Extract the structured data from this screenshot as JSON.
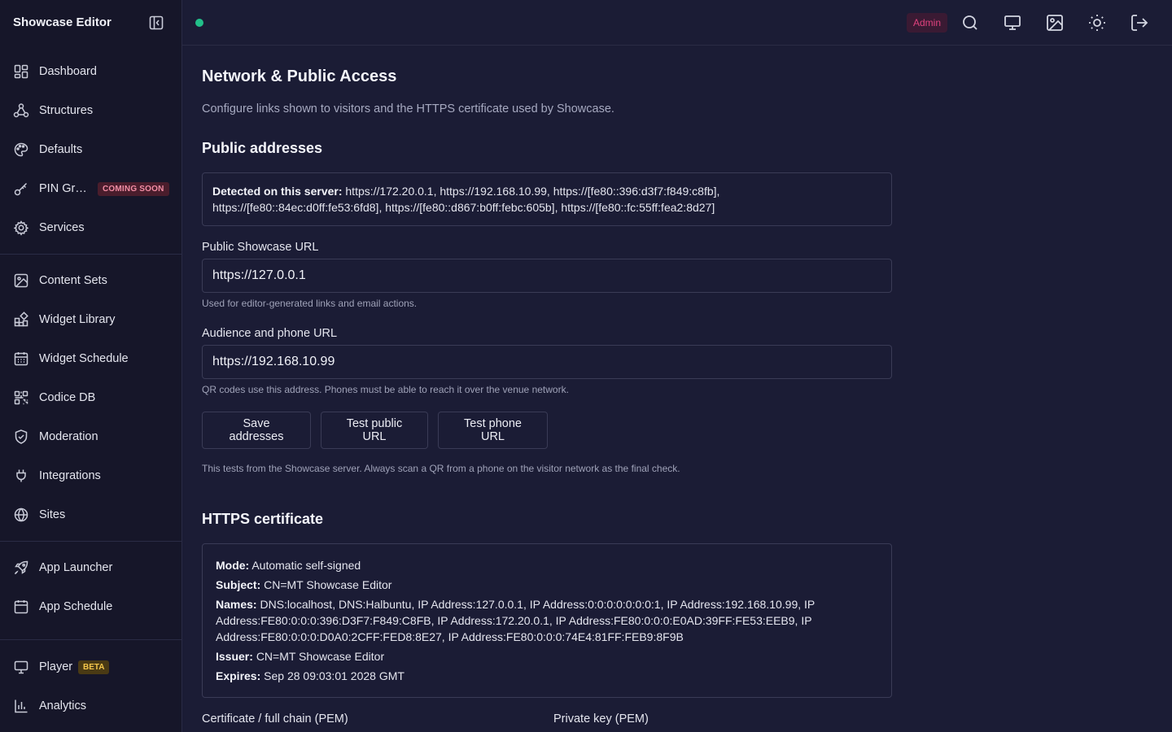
{
  "app": {
    "title": "Showcase Editor"
  },
  "sidebar": {
    "groups": [
      [
        {
          "label": "Dashboard",
          "icon": "dashboard-icon"
        },
        {
          "label": "Structures",
          "icon": "structures-icon"
        },
        {
          "label": "Defaults",
          "icon": "palette-icon"
        },
        {
          "label": "PIN Gr…",
          "icon": "key-icon",
          "badge": "COMING SOON"
        },
        {
          "label": "Services",
          "icon": "gear-icon"
        }
      ],
      [
        {
          "label": "Content Sets",
          "icon": "image-icon"
        },
        {
          "label": "Widget Library",
          "icon": "widgets-icon"
        },
        {
          "label": "Widget Schedule",
          "icon": "calendar-icon"
        },
        {
          "label": "Codice DB",
          "icon": "qr-icon"
        },
        {
          "label": "Moderation",
          "icon": "shield-icon"
        },
        {
          "label": "Integrations",
          "icon": "plug-icon"
        },
        {
          "label": "Sites",
          "icon": "globe-icon"
        }
      ],
      [
        {
          "label": "App Launcher",
          "icon": "rocket-icon"
        },
        {
          "label": "App Schedule",
          "icon": "calendar-icon"
        }
      ],
      [
        {
          "label": "Player",
          "icon": "monitor-icon",
          "badge": "BETA"
        },
        {
          "label": "Analytics",
          "icon": "bar-chart-icon"
        }
      ]
    ]
  },
  "topbar": {
    "admin_badge": "Admin",
    "status_color": "#22c08a"
  },
  "page": {
    "title": "Network & Public Access",
    "subtitle": "Configure links shown to visitors and the HTTPS certificate used by Showcase."
  },
  "public_addresses": {
    "heading": "Public addresses",
    "detected_label": "Detected on this server:",
    "detected_line1": "https://172.20.0.1, https://192.168.10.99, https://[fe80::396:d3f7:f849:c8fb],",
    "detected_line2": "https://[fe80::84ec:d0ff:fe53:6fd8], https://[fe80::d867:b0ff:febc:605b], https://[fe80::fc:55ff:fea2:8d27]",
    "public_url_label": "Public Showcase URL",
    "public_url_value": "https://127.0.0.1",
    "public_url_hint": "Used for editor-generated links and email actions.",
    "audience_url_label": "Audience and phone URL",
    "audience_url_value": "https://192.168.10.99",
    "audience_url_hint": "QR codes use this address. Phones must be able to reach it over the venue network.",
    "save_button": "Save addresses",
    "test_public_button": "Test public URL",
    "test_phone_button": "Test phone URL",
    "test_note": "This tests from the Showcase server. Always scan a QR from a phone on the visitor network as the final check."
  },
  "https_certificate": {
    "heading": "HTTPS certificate",
    "mode_label": "Mode:",
    "mode_value": "Automatic self-signed",
    "subject_label": "Subject:",
    "subject_value": "CN=MT Showcase Editor",
    "names_label": "Names:",
    "names_line1": "DNS:localhost, DNS:Halbuntu, IP Address:127.0.0.1, IP Address:0:0:0:0:0:0:0:1, IP Address:192.168.10.99, IP",
    "names_line2": "Address:FE80:0:0:0:396:D3F7:F849:C8FB, IP Address:172.20.0.1, IP Address:FE80:0:0:0:E0AD:39FF:FE53:EEB9, IP",
    "names_line3": "Address:FE80:0:0:0:D0A0:2CFF:FED8:8E27, IP Address:FE80:0:0:0:74E4:81FF:FEB9:8F9B",
    "issuer_label": "Issuer:",
    "issuer_value": "CN=MT Showcase Editor",
    "expires_label": "Expires:",
    "expires_value": "Sep 28 09:03:01 2028 GMT",
    "cert_chain_label": "Certificate / full chain (PEM)",
    "private_key_label": "Private key (PEM)"
  }
}
